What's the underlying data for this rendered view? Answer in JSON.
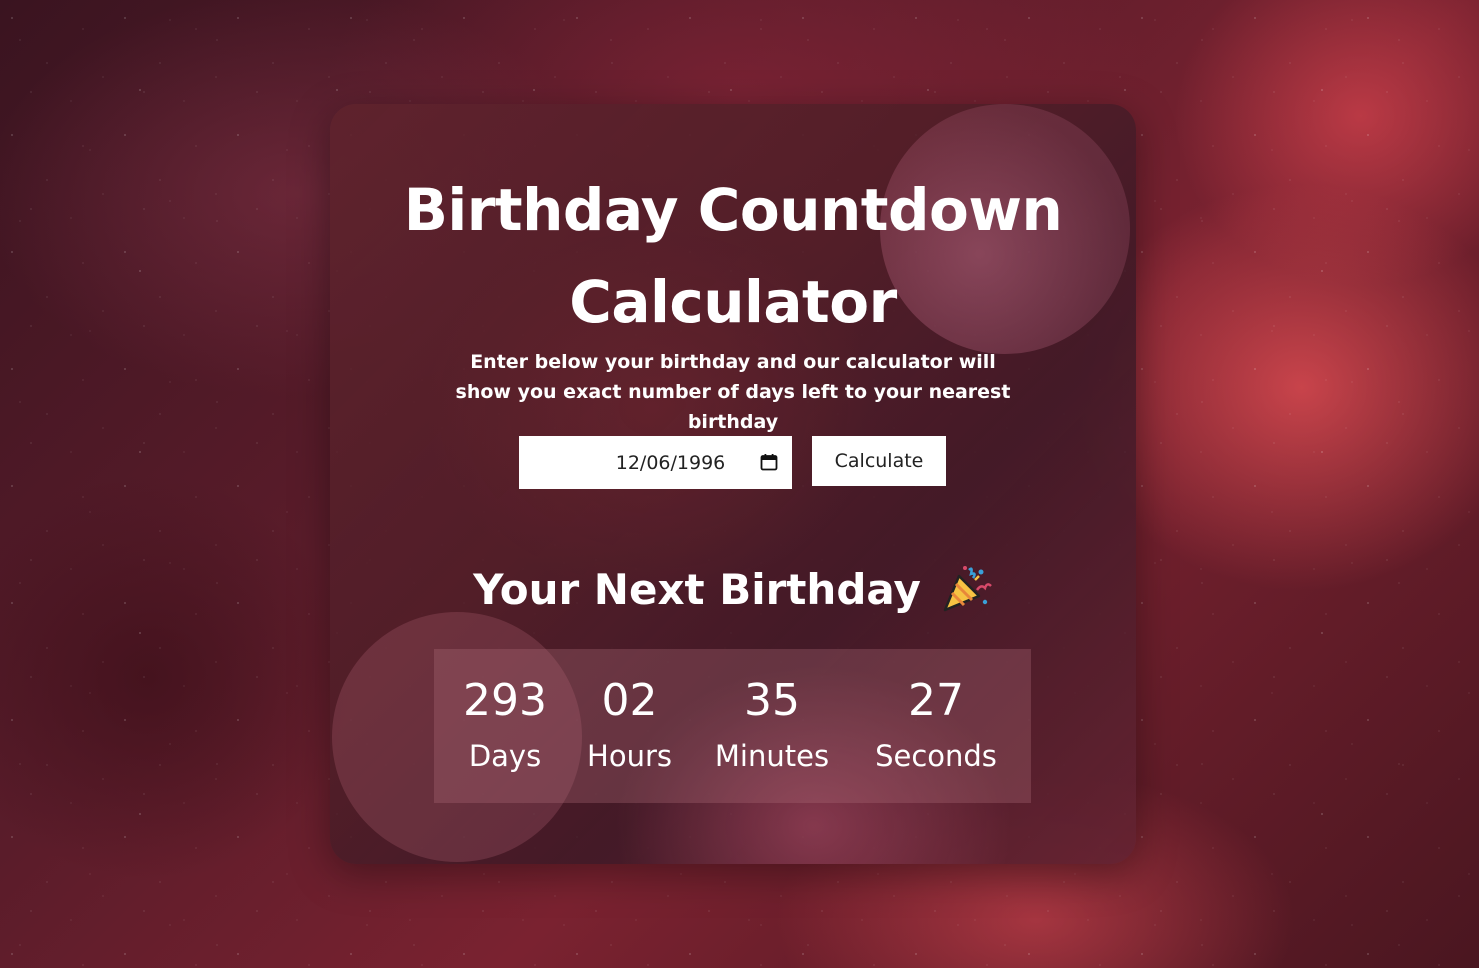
{
  "page": {
    "title": "Birthday Countdown Calculator",
    "subtitle": "Enter below your birthday and our calculator will show you exact number of days left to your nearest birthday"
  },
  "form": {
    "date_value": "12/06/1996",
    "calculate_label": "Calculate"
  },
  "result": {
    "heading": "Your Next Birthday",
    "heading_icon": "party-popper-icon",
    "units": [
      {
        "value": "293",
        "label": "Days"
      },
      {
        "value": "02",
        "label": "Hours"
      },
      {
        "value": "35",
        "label": "Minutes"
      },
      {
        "value": "27",
        "label": "Seconds"
      }
    ]
  },
  "colors": {
    "background": "#5a1c2a",
    "card": "#5f232d",
    "text": "#ffffff",
    "control_bg": "#ffffff"
  }
}
